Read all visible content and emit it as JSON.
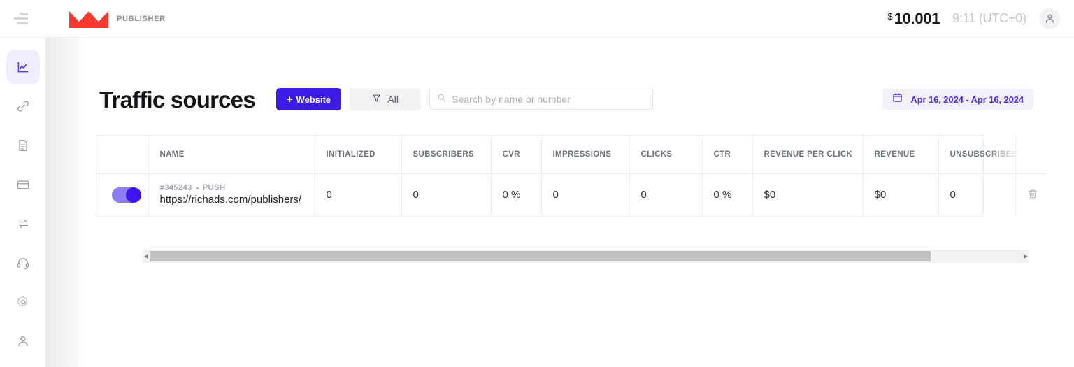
{
  "topbar": {
    "menu_icon": "hamburger-icon",
    "brand_logo_icon": "crown-logo-icon",
    "brand_label": "PUBLISHER",
    "balance_currency": "$",
    "balance_amount": "10.001",
    "clock": "9:11 (UTC+0)",
    "avatar_icon": "user-avatar-icon"
  },
  "sidebar": {
    "items": [
      {
        "icon": "chart-icon",
        "label": "Statistics",
        "active": true
      },
      {
        "icon": "link-icon",
        "label": "Traffic sources",
        "active": false
      },
      {
        "icon": "document-icon",
        "label": "Documents",
        "active": false
      },
      {
        "icon": "card-icon",
        "label": "Payments",
        "active": false
      },
      {
        "icon": "transfer-icon",
        "label": "Transfers",
        "active": false
      },
      {
        "icon": "headset-icon",
        "label": "Support",
        "active": false
      },
      {
        "icon": "gear-icon",
        "label": "Settings",
        "active": false
      },
      {
        "icon": "person-icon",
        "label": "Profile",
        "active": false
      }
    ]
  },
  "page": {
    "title": "Traffic sources",
    "add_website_label": "Website",
    "add_website_plus": "+",
    "filter_label": "All",
    "filter_icon": "funnel-icon"
  },
  "search": {
    "placeholder": "Search by name or number",
    "value": "",
    "icon": "search-icon"
  },
  "daterange": {
    "icon": "calendar-icon",
    "text": "Apr 16, 2024 - Apr 16, 2024"
  },
  "table": {
    "columns": [
      {
        "key": "toggle",
        "label": ""
      },
      {
        "key": "name",
        "label": "NAME"
      },
      {
        "key": "initialized",
        "label": "INITIALIZED"
      },
      {
        "key": "subscribers",
        "label": "SUBSCRIBERS"
      },
      {
        "key": "cvr",
        "label": "CVR"
      },
      {
        "key": "impressions",
        "label": "IMPRESSIONS"
      },
      {
        "key": "clicks",
        "label": "CLICKS"
      },
      {
        "key": "ctr",
        "label": "CTR"
      },
      {
        "key": "rpc",
        "label": "REVENUE PER CLICK"
      },
      {
        "key": "revenue",
        "label": "REVENUE"
      },
      {
        "key": "unsubscribes",
        "label": "UNSUBSCRIBES"
      },
      {
        "key": "actions",
        "label": ""
      }
    ],
    "rows": [
      {
        "enabled": true,
        "id": "#345243",
        "type": "PUSH",
        "url": "https://richads.com/publishers/",
        "initialized": "0",
        "subscribers": "0",
        "cvr": "0 %",
        "impressions": "0",
        "clicks": "0",
        "ctr": "0 %",
        "rpc": "$0",
        "revenue": "$0",
        "unsubscribes": "0",
        "delete_icon": "trash-icon"
      }
    ],
    "scrollbar": {
      "left_arrow": "◀",
      "right_arrow": "▶"
    }
  },
  "colors": {
    "accent": "#3d1ae8",
    "accent_soft": "#f3f1fe",
    "brand_red": "#f93a2f",
    "sidebar_active_bg": "#f0edfe"
  }
}
